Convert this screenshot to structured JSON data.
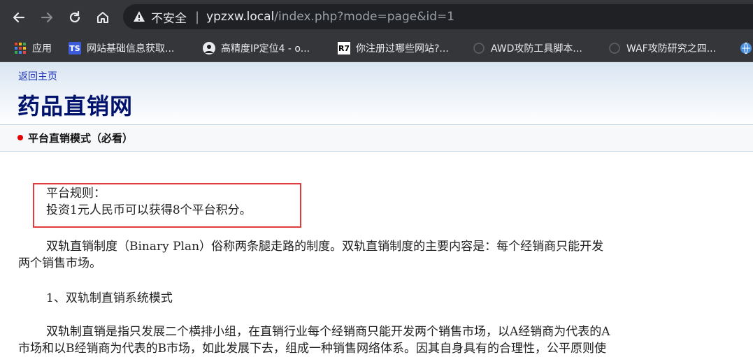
{
  "browser": {
    "insecure_label": "不安全",
    "separator": "|",
    "url_host": "ypzxw.local",
    "url_path": "/index.php?mode=page&id=1",
    "bookmarks": [
      {
        "label": "应用",
        "icon": "apps-grid-icon"
      },
      {
        "label": "网站基础信息获取...",
        "icon": "ts-logo-icon"
      },
      {
        "label": "高精度IP定位4 - o...",
        "icon": "avatar-icon"
      },
      {
        "label": "你注册过哪些网站?...",
        "icon": "r7-logo-icon"
      },
      {
        "label": "AWD攻防工具脚本...",
        "icon": "github-icon"
      },
      {
        "label": "WAF攻防研究之四...",
        "icon": "github-icon"
      }
    ]
  },
  "page": {
    "back_link": "返回主页",
    "site_title": "药品直销网",
    "nav_label": "平台直销模式（必看）",
    "rules_title": "平台规则：",
    "rules_text": "投资1元人民币可以获得8个平台积分。",
    "para1_line1": "双轨直销制度（Binary Plan）俗称两条腿走路的制度。双轨直销制度的主要内容是：每个经销商只能开发",
    "para1_line2": "两个销售市场。",
    "heading1": "1、双轨制直销系统模式",
    "para2_line1": "双轨制直销是指只发展二个横排小组，在直销行业每个经销商只能开发两个销售市场，以A经销商为代表的A",
    "para2_line2": "市场和以B经销商为代表的B市场，如此发展下去，组成一种销售网络体系。因其自身具有的合理性，公平原则使"
  },
  "colors": {
    "chrome_bg": "#35363a",
    "address_bg": "#202124",
    "title_color": "#00126b",
    "link_color": "#1a33b8",
    "highlight_border": "#e23b3b",
    "nav_dot": "#e60000"
  }
}
